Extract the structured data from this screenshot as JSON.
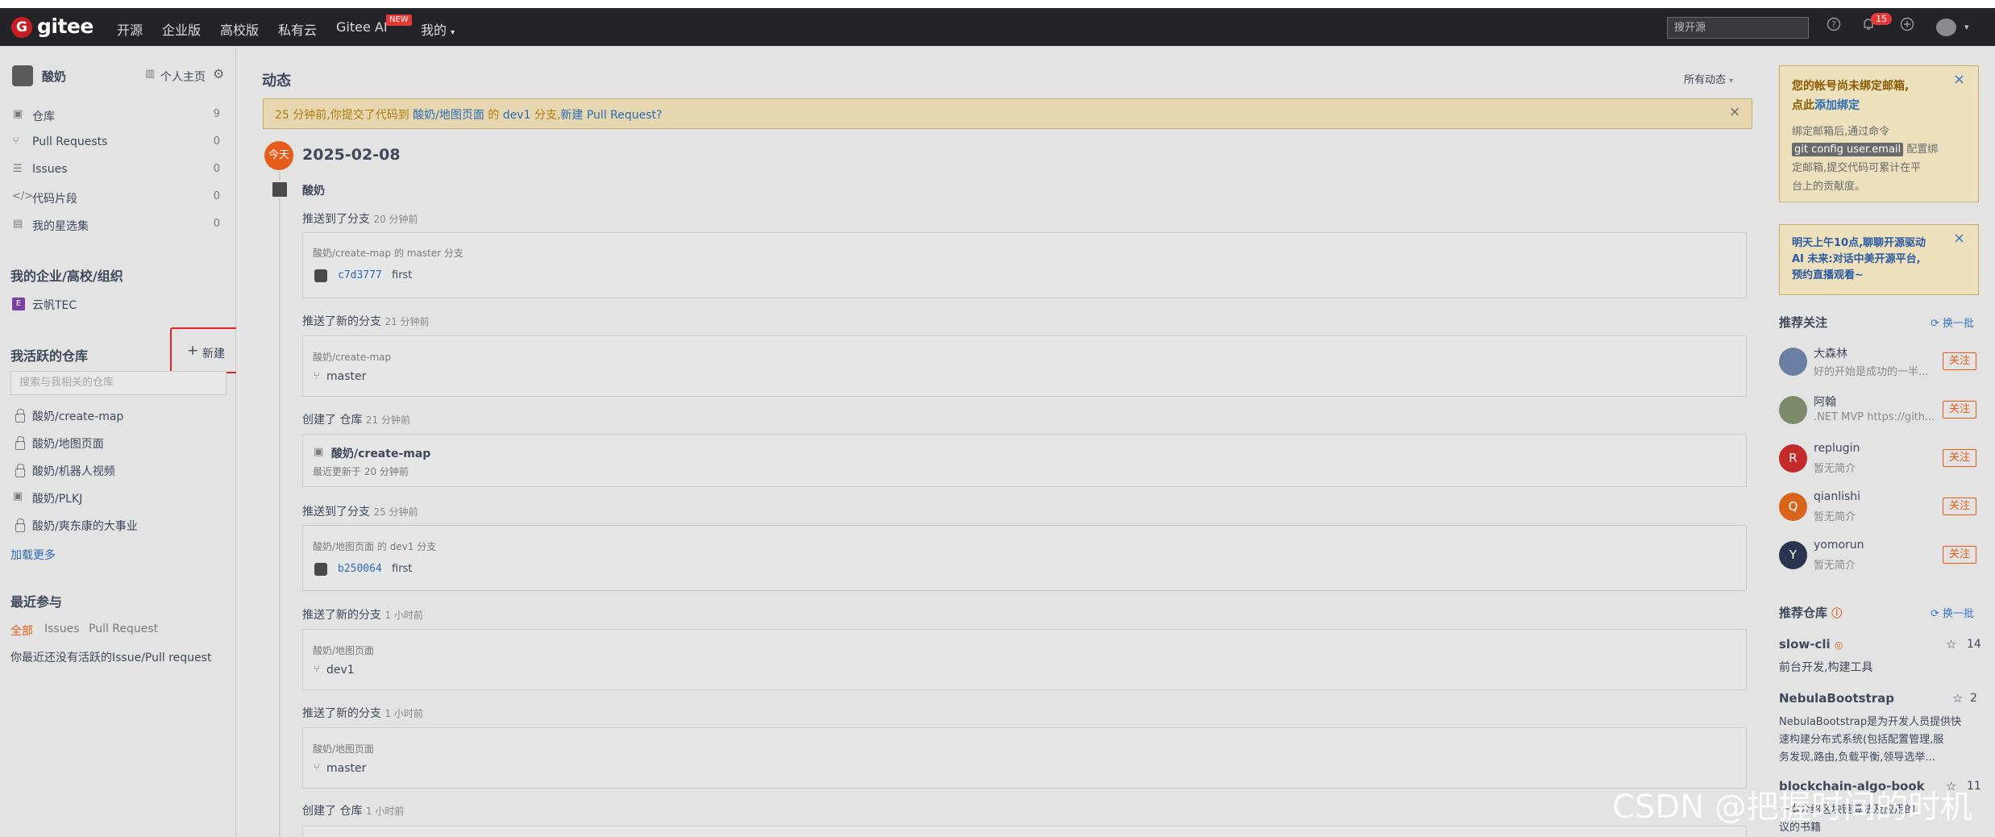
{
  "nav": {
    "logo_letter": "G",
    "logo_text": "gitee",
    "links": [
      "开源",
      "企业版",
      "高校版",
      "私有云",
      "Gitee AI",
      "我的"
    ],
    "new_badge": "NEW",
    "search_placeholder": "搜开源",
    "notification_count": "15"
  },
  "sidebar": {
    "username": "酸奶",
    "homepage_label": "个人主页",
    "items": [
      {
        "label": "仓库",
        "count": "9"
      },
      {
        "label": "Pull Requests",
        "count": "0"
      },
      {
        "label": "Issues",
        "count": "0"
      },
      {
        "label": "代码片段",
        "count": "0"
      },
      {
        "label": "我的星选集",
        "count": "0"
      }
    ],
    "org_title": "我的企业/高校/组织",
    "org_name": "云帆TEC",
    "org_letter": "E",
    "active_title": "我活跃的仓库",
    "new_label": "新建",
    "repo_search_placeholder": "搜索与我相关的仓库",
    "repos": [
      "酸奶/create-map",
      "酸奶/地图页面",
      "酸奶/机器人视频",
      "酸奶/PLKJ",
      "酸奶/爽东康的大事业"
    ],
    "load_more": "加载更多",
    "recent_title": "最近参与",
    "recent_tabs": [
      "全部",
      "Issues",
      "Pull Request"
    ],
    "recent_empty": "你最近还没有活跃的Issue/Pull request"
  },
  "feed": {
    "title": "动态",
    "filter": "所有动态",
    "notice_prefix": "25 分钟前,你提交了代码到",
    "notice_repo": "酸奶/地图页面",
    "notice_mid": "的",
    "notice_branch": "dev1",
    "notice_mid2": "分支,",
    "notice_link": "新建 Pull Request?",
    "today": "今天",
    "date": "2025-02-08",
    "user": "酸奶",
    "events": [
      {
        "action": "推送到了分支",
        "time": "20 分钟前",
        "repo": "酸奶/create-map",
        "branch_text": "的 master 分支",
        "hash": "c7d3777",
        "message": "first"
      },
      {
        "action": "推送了新的分支",
        "time": "21 分钟前",
        "repo": "酸奶/create-map",
        "branch": "master"
      },
      {
        "action": "创建了 仓库",
        "time": "21 分钟前",
        "repo": "酸奶/create-map",
        "updated": "最近更新于 20 分钟前"
      },
      {
        "action": "推送到了分支",
        "time": "25 分钟前",
        "repo": "酸奶/地图页面",
        "branch_text": "的 dev1 分支",
        "hash": "b250064",
        "message": "first"
      },
      {
        "action": "推送了新的分支",
        "time": "1 小时前",
        "repo": "酸奶/地图页面",
        "branch": "dev1"
      },
      {
        "action": "推送了新的分支",
        "time": "1 小时前",
        "repo": "酸奶/地图页面",
        "branch": "master"
      },
      {
        "action": "创建了 仓库",
        "time": "1 小时前"
      }
    ]
  },
  "right": {
    "email_title_1": "您的帐号尚未绑定邮箱,",
    "email_title_2": "点此",
    "email_title_link": "添加绑定",
    "email_body_1": "绑定邮箱后,通过命令",
    "email_code": "git config user.email",
    "email_body_2": "配置绑",
    "email_body_3": "定邮箱,提交代码可累计在平",
    "email_body_4": "台上的贡献度。",
    "event_line_1": "明天上午10点,聊聊开源驱动",
    "event_line_2": "AI 未来:对话中美开源平台,",
    "event_line_3": "预约直播观看~",
    "follow_title": "推荐关注",
    "refresh_label": "换一批",
    "users": [
      {
        "name": "大森林",
        "desc": "好的开始是成功的一半...",
        "color": "#6b7fa3",
        "letter": ""
      },
      {
        "name": "阿翰",
        "desc": ".NET MVP https://gith...",
        "color": "#7c8a6a",
        "letter": ""
      },
      {
        "name": "replugin",
        "desc": "暂无简介",
        "color": "#c42a2a",
        "letter": "R"
      },
      {
        "name": "qianlishi",
        "desc": "暂无简介",
        "color": "#d9651c",
        "letter": "Q"
      },
      {
        "name": "yomorun",
        "desc": "暂无简介",
        "color": "#2a3450",
        "letter": "Y"
      }
    ],
    "follow_label": "关注",
    "repos_title": "推荐仓库",
    "repos": [
      {
        "name": "slow-cli",
        "stars": "14",
        "desc_lines": [
          "前台开发,构建工具"
        ]
      },
      {
        "name": "NebulaBootstrap",
        "stars": "2",
        "desc_lines": [
          "NebulaBootstrap是为开发人员提供快",
          "速构建分布式系统(包括配置管理,服",
          "务发现,路由,负载平衡,领导选举..."
        ]
      },
      {
        "name": "blockchain-algo-book",
        "stars": "11",
        "desc_lines": [
          "一本介绍区块链算法及应用的",
          "议的书籍"
        ]
      }
    ]
  },
  "watermark": "CSDN @把握时间的时机"
}
